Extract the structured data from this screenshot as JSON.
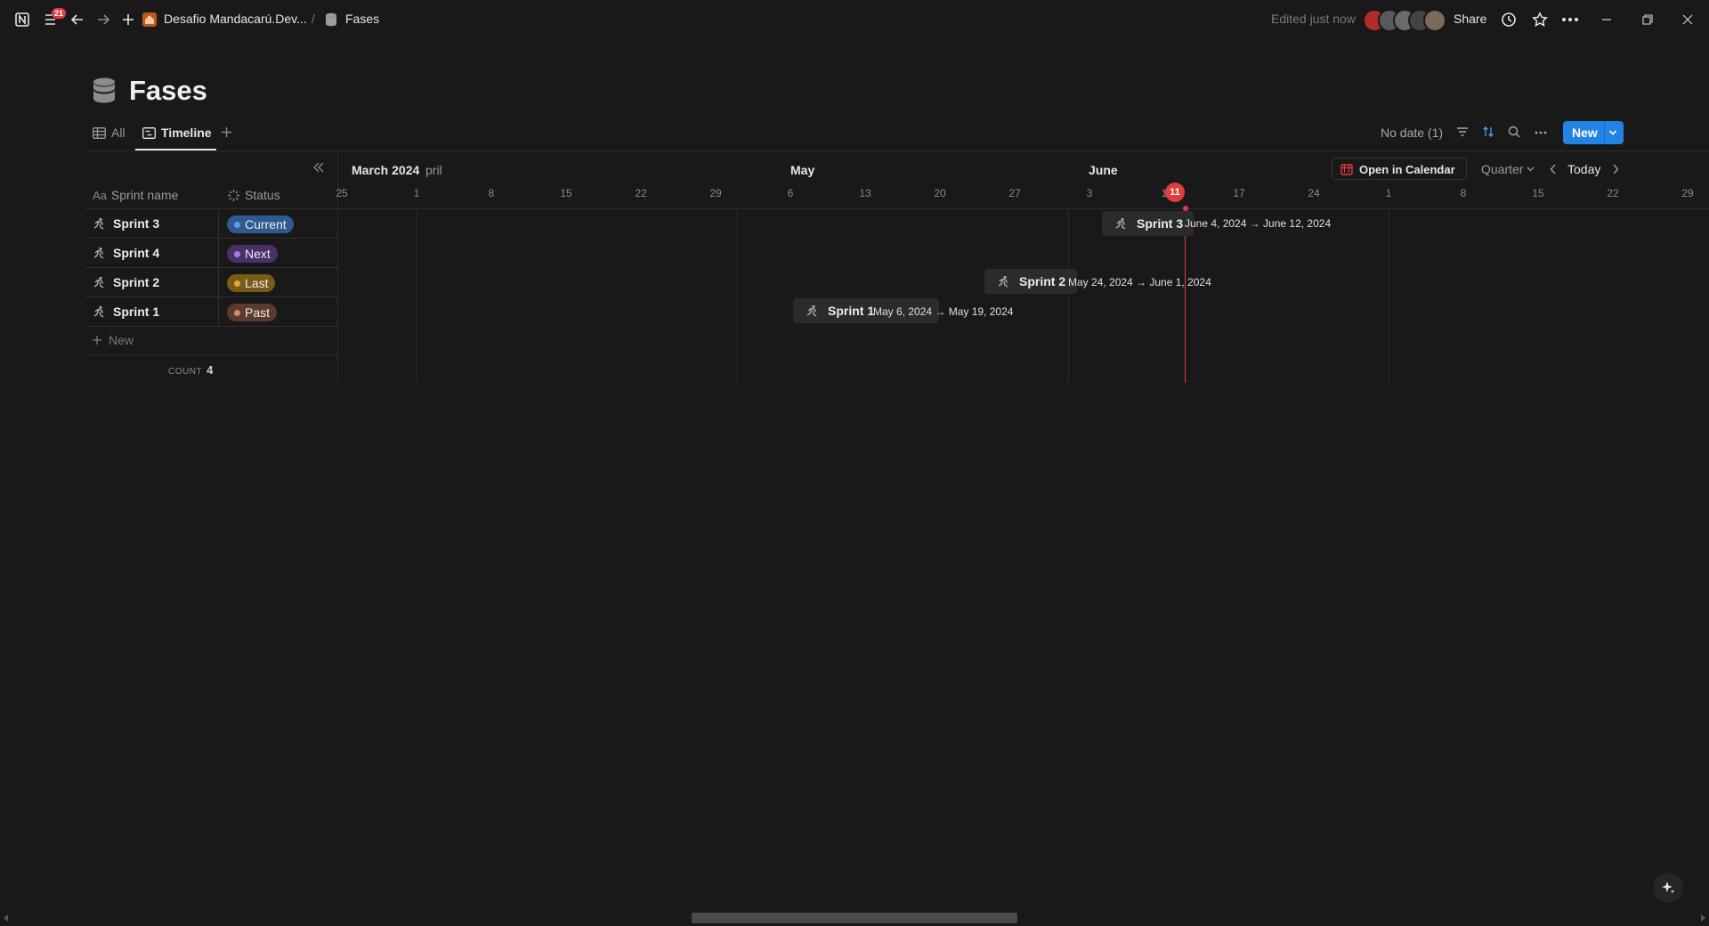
{
  "topbar": {
    "notification_count": "21",
    "breadcrumb_parent": "Desafio Mandacarú.Dev...",
    "breadcrumb_sep": "/",
    "breadcrumb_current": "Fases",
    "edited": "Edited just now",
    "share": "Share"
  },
  "page": {
    "title": "Fases"
  },
  "tabs": {
    "all": "All",
    "timeline": "Timeline"
  },
  "toolbar": {
    "no_date": "No date (1)",
    "new": "New"
  },
  "timeline_header": {
    "open_calendar": "Open in Calendar",
    "scale": "Quarter",
    "today": "Today",
    "months": [
      "March 2024",
      "pril",
      "May",
      "June"
    ],
    "days": [
      "25",
      "1",
      "8",
      "15",
      "22",
      "29",
      "6",
      "13",
      "20",
      "27",
      "3",
      "1",
      "11",
      "17",
      "24",
      "1",
      "8",
      "15",
      "22",
      "29"
    ],
    "today_day": "11"
  },
  "table": {
    "col_name": "Sprint name",
    "col_status": "Status",
    "rows": [
      {
        "name": "Sprint 3",
        "status": "Current",
        "color": "#2e5b8f",
        "dot": "#5b9ce6"
      },
      {
        "name": "Sprint 4",
        "status": "Next",
        "color": "#4b2f6b",
        "dot": "#b07ee0"
      },
      {
        "name": "Sprint 2",
        "status": "Last",
        "color": "#7a5a17",
        "dot": "#e0a93a"
      },
      {
        "name": "Sprint 1",
        "status": "Past",
        "color": "#5c3a2e",
        "dot": "#d98a6c"
      }
    ],
    "new_label": "New",
    "count_label": "COUNT",
    "count_value": "4"
  },
  "bars": [
    {
      "name": "Sprint 3",
      "dates": "June 4, 2024 → June 12, 2024"
    },
    {
      "name": "Sprint 2",
      "dates": "May 24, 2024 → June 1, 2024"
    },
    {
      "name": "Sprint 1",
      "dates": "May 6, 2024 → May 19, 2024"
    }
  ],
  "colors": {
    "accent": "#2383e2",
    "today": "#e03e3e",
    "background": "#191919"
  }
}
